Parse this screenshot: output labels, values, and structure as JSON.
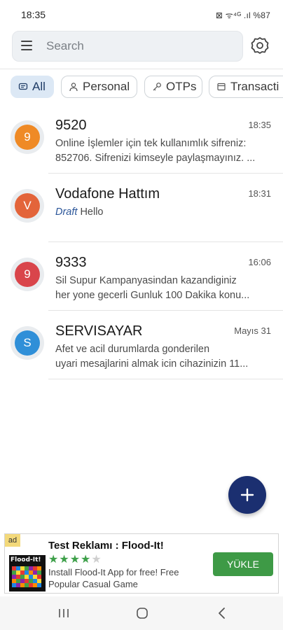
{
  "status_bar": {
    "time": "18:35",
    "icons_text": "⊠ ᯤ⁴ᴳ .ıl %87"
  },
  "search": {
    "placeholder": "Search"
  },
  "chips": [
    {
      "label": "All",
      "icon": "message-icon",
      "active": true
    },
    {
      "label": "Personal",
      "icon": "person-icon",
      "active": false
    },
    {
      "label": "OTPs",
      "icon": "key-icon",
      "active": false
    },
    {
      "label": "Transacti",
      "icon": "receipt-icon",
      "active": false
    }
  ],
  "messages": [
    {
      "sender": "9520",
      "time": "18:35",
      "avatar_letter": "9",
      "avatar_color": "#ef8a26",
      "line1": "Online İşlemler için tek kullanımlık sifreniz:",
      "line2": "852706. Sifrenizi kimseyle paylaşmayınız. ..."
    },
    {
      "sender": "Vodafone Hattım",
      "time": "18:31",
      "avatar_letter": "V",
      "avatar_color": "#e3643a",
      "draft_label": "Draft",
      "line1": "Hello"
    },
    {
      "sender": "9333",
      "time": "16:06",
      "avatar_letter": "9",
      "avatar_color": "#d9454b",
      "line1": "Sil Supur Kampanyasindan kazandiginiz",
      "line2": "her yone gecerli Gunluk 100 Dakika konu..."
    },
    {
      "sender": "SERVISAYAR",
      "time": "Mayıs 31",
      "avatar_letter": "S",
      "avatar_color": "#2f8fd8",
      "line1": "Afet ve acil durumlarda gonderilen",
      "line2": "uyari mesajlarini almak icin cihazinizin 11..."
    }
  ],
  "ad": {
    "badge": "ad",
    "title": "Test Reklamı : Flood-It!",
    "logo_text": "Flood-It!",
    "rating": 4,
    "stars_filled": "★★★★",
    "stars_empty": "★",
    "description": "Install Flood-It App for free! Free Popular Casual Game",
    "cta": "YÜKLE"
  },
  "colors": {
    "accent": "#1b2f70",
    "chip_active_bg": "#dce8f5",
    "cta_green": "#3e9a46"
  }
}
